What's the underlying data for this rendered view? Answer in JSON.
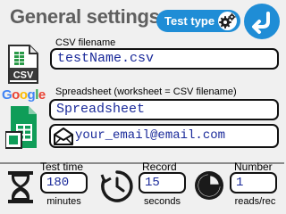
{
  "header": {
    "title": "General settings",
    "test_type_label": "Test type",
    "icons": {
      "settings": "gear-icon",
      "back": "back-arrow-icon"
    },
    "accent_color": "#1f8dd6"
  },
  "csv": {
    "label": "CSV filename",
    "value": "testName.csv",
    "icon": "csv-file-icon",
    "icon_text": "CSV"
  },
  "spreadsheet": {
    "brand": "Google",
    "label": "Spreadsheet (worksheet = CSV filename)",
    "value": "Spreadsheet",
    "email_value": "your_email@email.com",
    "icons": {
      "sheets": "google-sheets-icon",
      "email": "email-icon"
    }
  },
  "timing": {
    "test_time": {
      "label": "Test time",
      "value": "180",
      "unit": "minutes",
      "icon": "hourglass-icon"
    },
    "record": {
      "label": "Record",
      "value": "15",
      "unit": "seconds",
      "icon": "clock-icon"
    },
    "number": {
      "label": "Number",
      "value": "1",
      "unit": "reads/rec",
      "icon": "pie-chart-icon"
    }
  }
}
